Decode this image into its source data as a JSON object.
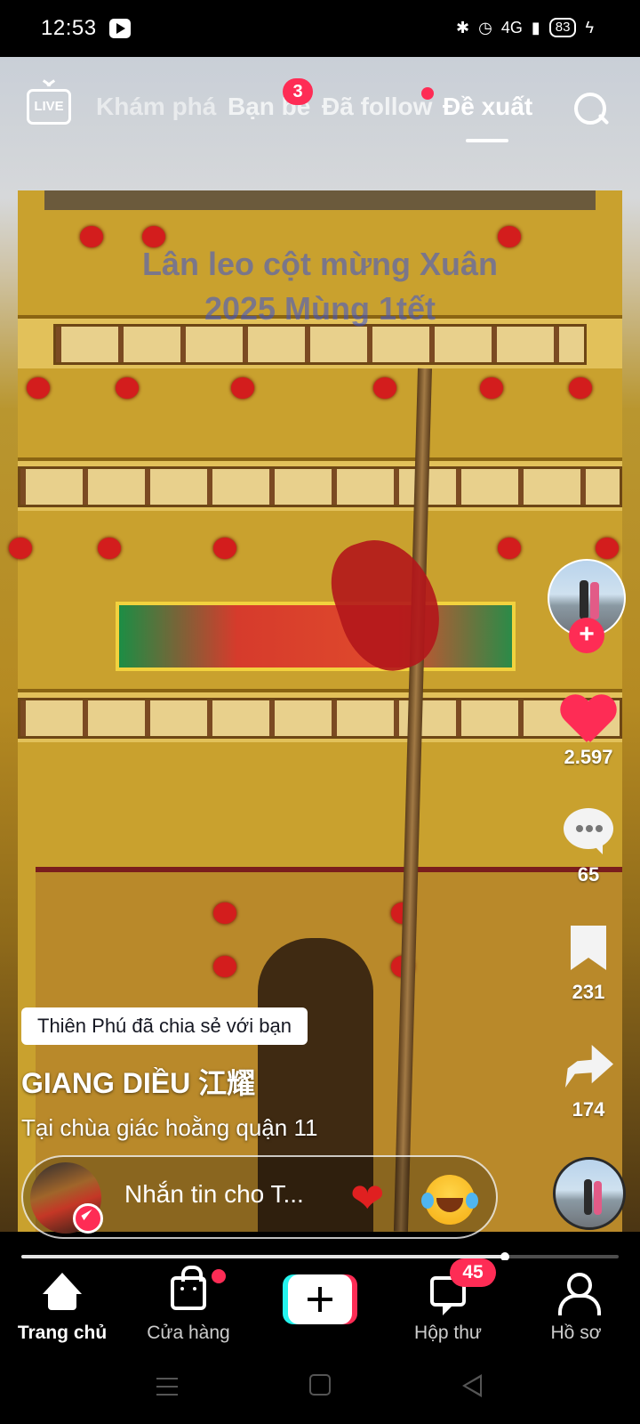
{
  "status_bar": {
    "time": "12:53",
    "network": "4G",
    "battery": "83"
  },
  "top_nav": {
    "live_label": "LIVE",
    "tabs": [
      {
        "label": "Khám phá"
      },
      {
        "label": "Bạn bè",
        "badge": "3"
      },
      {
        "label": "Đã follow",
        "has_dot": true
      },
      {
        "label": "Đề xuất",
        "active": true
      }
    ]
  },
  "video": {
    "overlay_text_line1": "Lân leo cột mừng Xuân",
    "overlay_text_line2": "2025 Mùng 1tết",
    "progress": 0.81
  },
  "right_rail": {
    "follow_symbol": "+",
    "likes": "2.597",
    "comments": "65",
    "saves": "231",
    "shares": "174"
  },
  "caption": {
    "shared_by": "Thiên Phú đã chia sẻ với bạn",
    "author": "GIANG DIỀU 江耀",
    "description": "Tại chùa giác hoằng quận 11"
  },
  "message_bar": {
    "placeholder": "Nhắn tin cho T...",
    "quick_heart": "❤",
    "quick_emoji": "laughing-tears-emoji"
  },
  "bottom_nav": {
    "items": [
      {
        "label": "Trang chủ",
        "active": true
      },
      {
        "label": "Cửa hàng",
        "has_dot": true
      },
      {
        "label": "",
        "icon": "plus-icon"
      },
      {
        "label": "Hộp thư",
        "badge": "45"
      },
      {
        "label": "Hồ sơ"
      }
    ]
  },
  "colors": {
    "accent": "#fe2c55",
    "cyan": "#25f4ee",
    "overlay_text": "#3a53d6"
  }
}
